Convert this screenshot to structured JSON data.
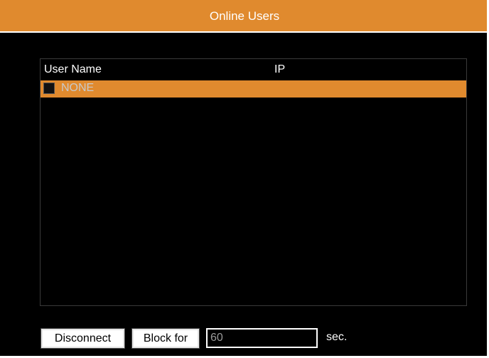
{
  "window": {
    "title": "Online Users"
  },
  "table": {
    "columns": [
      "User Name",
      "IP"
    ],
    "rows": [
      {
        "user_name": "NONE",
        "ip": "",
        "checked": false,
        "selected": true
      }
    ]
  },
  "actions": {
    "disconnect_label": "Disconnect",
    "block_label": "Block for",
    "block_duration_value": "60",
    "unit_label": "sec."
  },
  "colors": {
    "accent": "#e08a2e",
    "background": "#000000",
    "text": "#ffffff",
    "muted_text": "#9a9a9a"
  }
}
